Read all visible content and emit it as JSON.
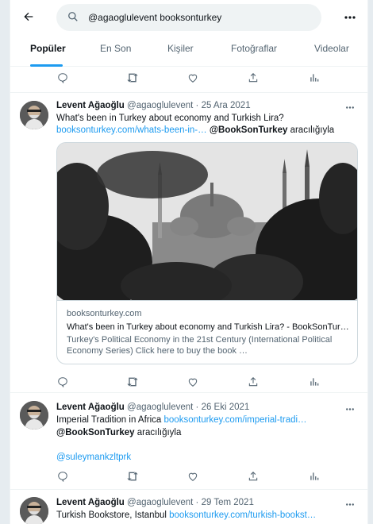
{
  "search": {
    "query": "@agaoglulevent booksonturkey"
  },
  "tabs": [
    "Popüler",
    "En Son",
    "Kişiler",
    "Fotoğraflar",
    "Videolar"
  ],
  "tweets": [
    {
      "name": "Levent Ağaoğlu",
      "handle": "@agaoglulevent",
      "date": "· 25 Ara 2021",
      "line1": "What's been in Turkey about economy and Turkish Lira?",
      "link": "booksonturkey.com/whats-been-in-…",
      "mention": "@BookSonTurkey",
      "via": "aracılığıyla",
      "card": {
        "domain": "booksonturkey.com",
        "title": "What's been in Turkey about economy and Turkish Lira? - BookSonTur…",
        "desc1": "Turkey's Political Economy in the 21st Century (International Political",
        "desc2": "Economy Series) Click here to buy the book …"
      }
    },
    {
      "name": "Levent Ağaoğlu",
      "handle": "@agaoglulevent",
      "date": "· 26 Eki 2021",
      "line1": "Imperial Tradition in Africa",
      "link": "booksonturkey.com/imperial-tradi…",
      "mention": "@BookSonTurkey",
      "via": "aracılığıyla",
      "mention2": "@suleymankzltprk"
    },
    {
      "name": "Levent Ağaoğlu",
      "handle": "@agaoglulevent",
      "date": "· 29 Tem 2021",
      "line1": "Turkish Bookstore, Istanbul",
      "link": "booksonturkey.com/turkish-bookst…"
    }
  ],
  "icons": [
    "back-arrow-icon",
    "search-icon",
    "more-icon",
    "reply-icon",
    "retweet-icon",
    "like-icon",
    "share-icon",
    "analytics-icon"
  ],
  "colors": {
    "accent": "#1d9bf0",
    "text": "#0f1419",
    "secondary": "#536471"
  }
}
